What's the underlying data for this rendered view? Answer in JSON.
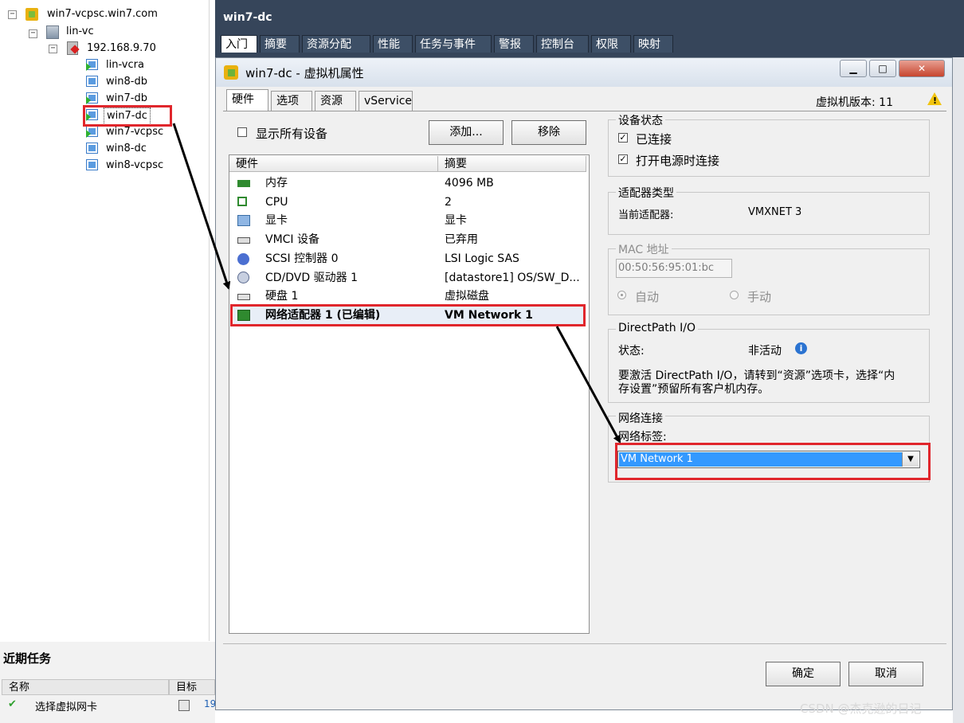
{
  "tree": {
    "root": "win7-vcpsc.win7.com",
    "datacenter": "lin-vc",
    "host": "192.168.9.70",
    "vms": [
      "lin-vcra",
      "win8-db",
      "win7-db",
      "win7-dc",
      "win7-vcpsc",
      "win8-dc",
      "win8-vcpsc"
    ],
    "selected_vm": "win7-dc"
  },
  "recent_tasks": {
    "title": "近期任务",
    "col_name": "名称",
    "col_target": "目标",
    "row_name": "选择虚拟网卡",
    "row_target_partial": "19"
  },
  "main": {
    "title": "win7-dc",
    "tabs": [
      "入门",
      "摘要",
      "资源分配",
      "性能",
      "任务与事件",
      "警报",
      "控制台",
      "权限",
      "映射"
    ]
  },
  "dialog": {
    "title": "win7-dc - 虚拟机属性",
    "tabs": [
      "硬件",
      "选项",
      "资源",
      "vService"
    ],
    "vm_version": "虚拟机版本: 11",
    "show_all_devices": "显示所有设备",
    "add_button": "添加...",
    "remove_button": "移除",
    "list_header_hw": "硬件",
    "list_header_summary": "摘要",
    "hardware": [
      {
        "name": "内存",
        "summary": "4096 MB",
        "icon": "memory-icon"
      },
      {
        "name": "CPU",
        "summary": "2",
        "icon": "cpu-icon"
      },
      {
        "name": "显卡",
        "summary": "显卡",
        "icon": "video-card-icon"
      },
      {
        "name": "VMCI 设备",
        "summary": "已弃用",
        "icon": "vmci-device-icon"
      },
      {
        "name": "SCSI 控制器 0",
        "summary": "LSI Logic SAS",
        "icon": "scsi-controller-icon"
      },
      {
        "name": "CD/DVD 驱动器 1",
        "summary": "[datastore1] OS/SW_D...",
        "icon": "cdrom-icon"
      },
      {
        "name": "硬盘 1",
        "summary": "虚拟磁盘",
        "icon": "hard-disk-icon"
      },
      {
        "name": "网络适配器 1 (已编辑)",
        "summary": "VM Network 1",
        "icon": "network-adapter-icon"
      }
    ],
    "device_status": {
      "title": "设备状态",
      "connected": "已连接",
      "connect_at_power_on": "打开电源时连接"
    },
    "adapter_type": {
      "title": "适配器类型",
      "label": "当前适配器:",
      "value": "VMXNET 3"
    },
    "mac": {
      "title": "MAC 地址",
      "value": "00:50:56:95:01:bc",
      "auto": "自动",
      "manual": "手动"
    },
    "directpath": {
      "title": "DirectPath I/O",
      "status_label": "状态:",
      "status_value": "非活动",
      "note_line1": "要激活 DirectPath I/O，请转到“资源”选项卡，选择“内",
      "note_line2": "存设置”预留所有客户机内存。"
    },
    "network": {
      "title": "网络连接",
      "label_caption": "网络标签:",
      "selected": "VM Network 1"
    },
    "ok_button": "确定",
    "cancel_button": "取消"
  },
  "watermark": "CSDN @杰克逊的日记"
}
